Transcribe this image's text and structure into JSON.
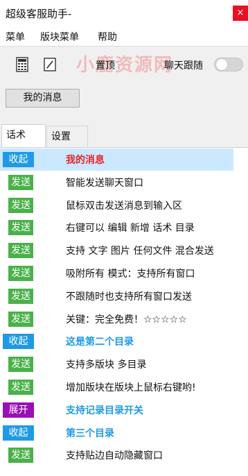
{
  "window": {
    "title": "超级客服助手-",
    "close_glyph": "×"
  },
  "menu": {
    "items": [
      "菜单",
      "版块菜单",
      "帮助"
    ]
  },
  "toolbar": {
    "watermark": "小鹿资源网",
    "pin_label": "置顶",
    "follow_label": "聊天跟随",
    "follow_enabled": false
  },
  "messages_button": "我的消息",
  "tabs": [
    "话术",
    "设置"
  ],
  "rows": [
    {
      "badge": "收起",
      "badge_type": "blue",
      "text": "我的消息",
      "style": "header-red",
      "selected": true
    },
    {
      "badge": "发送",
      "badge_type": "green",
      "text": "智能发送聊天窗口"
    },
    {
      "badge": "发送",
      "badge_type": "green",
      "text": "鼠标双击发送消息到输入区"
    },
    {
      "badge": "发送",
      "badge_type": "green",
      "text": "右键可以 编辑 新增 话术 目录"
    },
    {
      "badge": "发送",
      "badge_type": "green",
      "text": "支持 文字 图片 任何文件 混合发送"
    },
    {
      "badge": "发送",
      "badge_type": "green",
      "text": "吸附所有 模式：支持所有窗口"
    },
    {
      "badge": "发送",
      "badge_type": "green",
      "text": "不跟随时也支持所有窗口发送"
    },
    {
      "badge": "发送",
      "badge_type": "green",
      "text": "关键：完全免费！☆☆☆☆☆"
    },
    {
      "badge": "收起",
      "badge_type": "blue",
      "text": "这是第二个目录",
      "style": "header-blue"
    },
    {
      "badge": "发送",
      "badge_type": "green",
      "text": "支持多版块 多目录"
    },
    {
      "badge": "发送",
      "badge_type": "green",
      "text": "增加版块在版块上鼠标右键哟!"
    },
    {
      "badge": "展开",
      "badge_type": "purple",
      "text": "支持记录目录开关",
      "style": "header-blue"
    },
    {
      "badge": "收起",
      "badge_type": "blue",
      "text": "第三个目录",
      "style": "header-blue"
    },
    {
      "badge": "发送",
      "badge_type": "green",
      "text": "支持贴边自动隐藏窗口"
    }
  ],
  "colors": {
    "header_red": "#e0282c",
    "header_blue": "#1f9ae6",
    "send_green": "#4ab14a",
    "collapse_blue": "#1f9ae6",
    "expand_purple": "#9a0fb5",
    "selected_row": "#cce8ff"
  }
}
